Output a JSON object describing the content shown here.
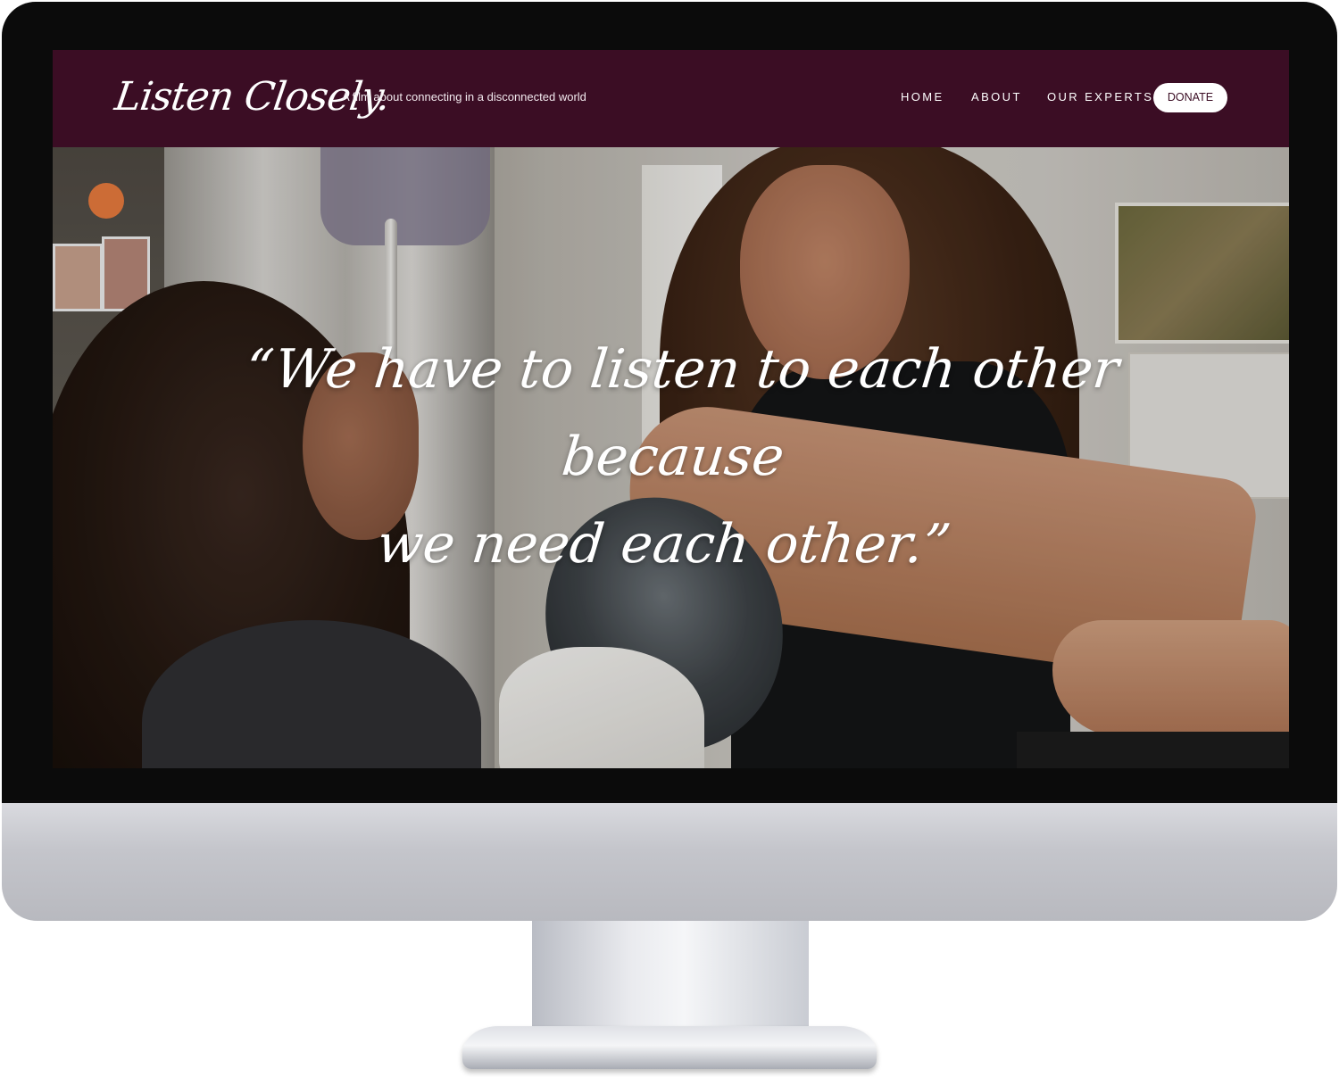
{
  "site": {
    "logo_text": "Listen Closely.",
    "tagline": "A film about connecting in a disconnected world"
  },
  "nav": {
    "items": [
      {
        "label": "HOME"
      },
      {
        "label": "ABOUT"
      },
      {
        "label": "OUR EXPERTS"
      }
    ],
    "donate_label": "DONATE"
  },
  "hero": {
    "quote_line_1": "“We have to listen to each other because",
    "quote_line_2": "we need each other.”"
  },
  "colors": {
    "header_bg": "#3b0d24",
    "donate_text": "#3b0d24",
    "nav_text": "#ffffff"
  }
}
